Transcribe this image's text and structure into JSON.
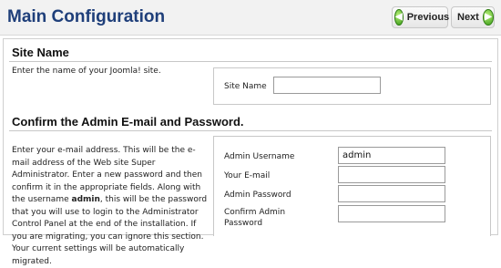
{
  "header": {
    "title": "Main Configuration",
    "previous_label": "Previous",
    "next_label": "Next"
  },
  "site": {
    "heading": "Site Name",
    "description": "Enter the name of your Joomla! site.",
    "site_name_label": "Site Name",
    "site_name_value": ""
  },
  "admin": {
    "heading": "Confirm the Admin E-mail and Password.",
    "description_part1": "Enter your e-mail address. This will be the e-mail address of the Web site Super Administrator. Enter a new password and then confirm it in the appropriate fields. Along with the username ",
    "description_bold": "admin",
    "description_part2": ", this will be the password that you will use to login to the Administrator Control Panel at the end of the installation. If you are migrating, you can ignore this section. Your current settings will be automatically migrated.",
    "username_label": "Admin Username",
    "username_value": "admin",
    "email_label": "Your E-mail",
    "email_value": "",
    "password_label": "Admin Password",
    "password_value": "",
    "confirm_label": "Confirm Admin Password",
    "confirm_value": ""
  },
  "colors": {
    "title": "#1f3f7a",
    "button_green": "#3f9f1a"
  }
}
